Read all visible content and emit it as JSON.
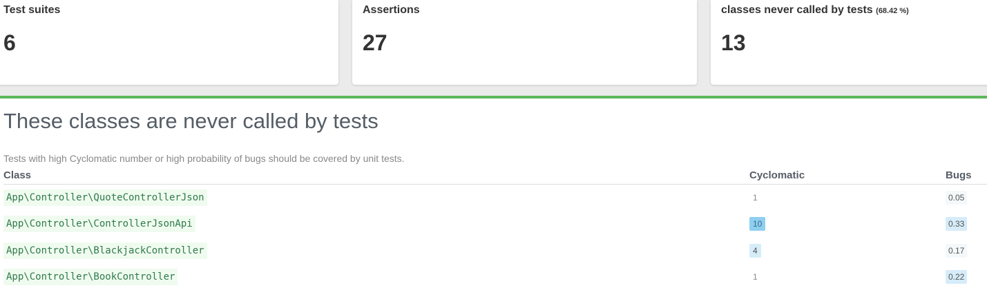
{
  "cards": [
    {
      "title": "Test suites",
      "value": "6",
      "percent": ""
    },
    {
      "title": "Assertions",
      "value": "27",
      "percent": ""
    },
    {
      "title": "classes never called by tests",
      "value": "13",
      "percent": "(68.42 %)"
    }
  ],
  "section": {
    "heading": "These classes are never called by tests",
    "description": "Tests with high Cyclomatic number or high probability of bugs should be covered by unit tests."
  },
  "table": {
    "headers": {
      "class": "Class",
      "cyclomatic": "Cyclomatic",
      "bugs": "Bugs"
    },
    "rows": [
      {
        "class": "App\\Controller\\QuoteControllerJson",
        "cyclomatic": "1",
        "bugs": "0.05"
      },
      {
        "class": "App\\Controller\\ControllerJsonApi",
        "cyclomatic": "10",
        "bugs": "0.33"
      },
      {
        "class": "App\\Controller\\BlackjackController",
        "cyclomatic": "4",
        "bugs": "0.17"
      },
      {
        "class": "App\\Controller\\BookController",
        "cyclomatic": "1",
        "bugs": "0.22"
      }
    ]
  },
  "colors": {
    "accent_divider": "#5cb85c",
    "class_text": "#2f7a4a",
    "class_bg": "#f0fbf0",
    "badge_high": "#8ecff0",
    "badge_mid": "#d6ecf9"
  }
}
